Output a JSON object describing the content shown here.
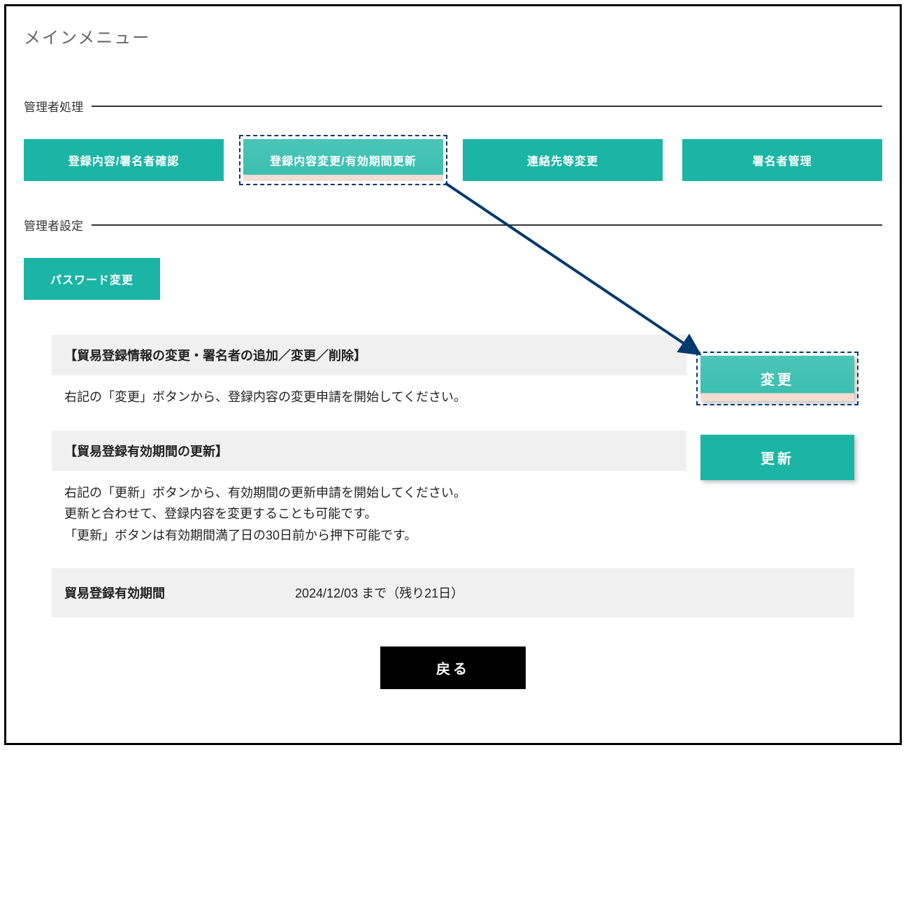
{
  "page": {
    "title": "メインメニュー"
  },
  "sections": {
    "admin_process": {
      "label": "管理者処理",
      "buttons": {
        "confirm": "登録内容/署名者確認",
        "change_update": "登録内容変更/有効期間更新",
        "contact_change": "連絡先等変更",
        "signer_manage": "署名者管理"
      }
    },
    "admin_settings": {
      "label": "管理者設定",
      "buttons": {
        "password": "パスワード変更"
      }
    }
  },
  "trade": {
    "change": {
      "header": "【貿易登録情報の変更・署名者の追加／変更／削除】",
      "desc": "右記の「変更」ボタンから、登録内容の変更申請を開始してください。",
      "button": "変更"
    },
    "renew": {
      "header": "【貿易登録有効期間の更新】",
      "desc_line1": "右記の「更新」ボタンから、有効期間の更新申請を開始してください。",
      "desc_line2": "更新と合わせて、登録内容を変更することも可能です。",
      "desc_line3": "「更新」ボタンは有効期間満了日の30日前から押下可能です。",
      "button": "更新"
    },
    "validity": {
      "label": "貿易登録有効期間",
      "value": "2024/12/03 まで（残り21日）"
    }
  },
  "back_button": "戻る"
}
